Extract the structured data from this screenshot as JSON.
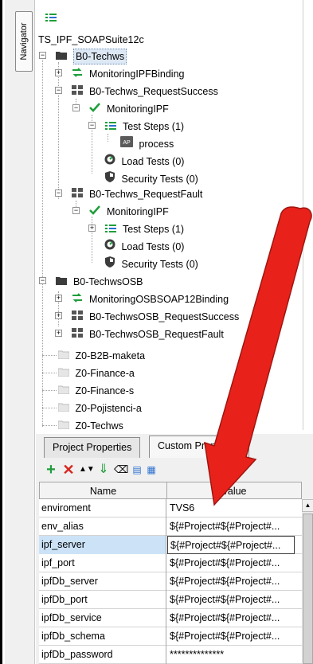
{
  "navigator": {
    "tab_label": "Navigator"
  },
  "tree": {
    "root": "TS_IPF_SOAPSuite12c",
    "items": [
      {
        "label": "B0-Techws"
      },
      {
        "label": "MonitoringIPFBinding"
      },
      {
        "label": "B0-Techws_RequestSuccess"
      },
      {
        "label": "MonitoringIPF"
      },
      {
        "label": "Test Steps (1)"
      },
      {
        "label": "process"
      },
      {
        "label": "Load Tests (0)"
      },
      {
        "label": "Security Tests (0)"
      },
      {
        "label": "B0-Techws_RequestFault"
      },
      {
        "label": "MonitoringIPF"
      },
      {
        "label": "Test Steps (1)"
      },
      {
        "label": "Load Tests (0)"
      },
      {
        "label": "Security Tests (0)"
      },
      {
        "label": "B0-TechwsOSB"
      },
      {
        "label": "MonitoringOSBSOAP12Binding"
      },
      {
        "label": "B0-TechwsOSB_RequestSuccess"
      },
      {
        "label": "B0-TechwsOSB_RequestFault"
      },
      {
        "label": "Z0-B2B-maketa"
      },
      {
        "label": "Z0-Finance-a"
      },
      {
        "label": "Z0-Finance-s"
      },
      {
        "label": "Z0-Pojistenci-a"
      },
      {
        "label": "Z0-Techws"
      }
    ]
  },
  "properties": {
    "tabs": [
      "Project Properties",
      "Custom Properties"
    ],
    "columns": [
      "Name",
      "Value"
    ],
    "rows": [
      {
        "name": "enviroment",
        "value": "TVS6"
      },
      {
        "name": "env_alias",
        "value": "${#Project#${#Project#..."
      },
      {
        "name": "ipf_server",
        "value": "${#Project#${#Project#..."
      },
      {
        "name": "ipf_port",
        "value": "${#Project#${#Project#..."
      },
      {
        "name": "ipfDb_server",
        "value": "${#Project#${#Project#..."
      },
      {
        "name": "ipfDb_port",
        "value": "${#Project#${#Project#..."
      },
      {
        "name": "ipfDb_service",
        "value": "${#Project#${#Project#..."
      },
      {
        "name": "ipfDb_schema",
        "value": "${#Project#${#Project#..."
      },
      {
        "name": "ipfDb_password",
        "value": "**************"
      }
    ]
  },
  "colors": {
    "accent_arrow": "#e8221b",
    "selection": "#cce3f7",
    "folder_dark": "#3c3c3c",
    "green": "#1e9e3a"
  }
}
